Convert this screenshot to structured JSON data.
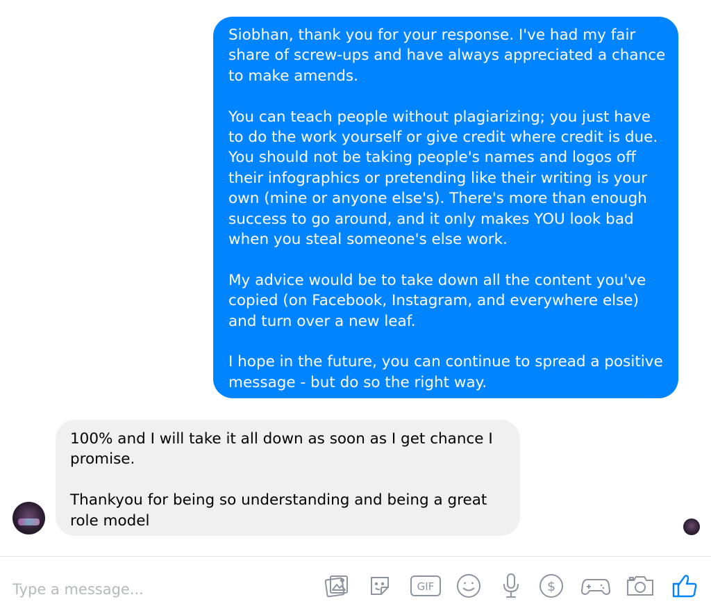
{
  "thread": {
    "outgoing_message": {
      "paragraphs": [
        "Siobhan, thank you for your response. I've had my fair share of screw-ups and have always appreciated a chance to make amends.",
        "You can teach people without plagiarizing; you just have to do the work yourself or give credit where credit is due. You should not be taking people's names and logos off their infographics or pretending like their writing is your own (mine or anyone else's). There's more than enough success to go around, and it only makes YOU look bad when you steal someone's else work.",
        "My advice would be to take down all the content you've copied (on Facebook, Instagram, and everywhere else) and turn over a new leaf.",
        "I hope in the future, you can continue to spread a positive message - but do so the right way."
      ]
    },
    "incoming_message": {
      "paragraphs": [
        "100% and I will take it all down as soon as I get chance I promise.",
        "Thankyou for being so understanding and being a great role model"
      ]
    }
  },
  "composer": {
    "placeholder": "Type a message...",
    "icons": [
      "image-icon",
      "sticker-icon",
      "gif-icon",
      "emoji-icon",
      "microphone-icon",
      "payment-icon",
      "game-icon",
      "camera-icon",
      "like-icon"
    ],
    "gif_label": "GIF",
    "payment_symbol": "$"
  },
  "colors": {
    "outgoing_bubble": "#0084ff",
    "incoming_bubble": "#f1f0f0",
    "icon_gray": "#8d949e",
    "like_blue": "#0084ff"
  }
}
